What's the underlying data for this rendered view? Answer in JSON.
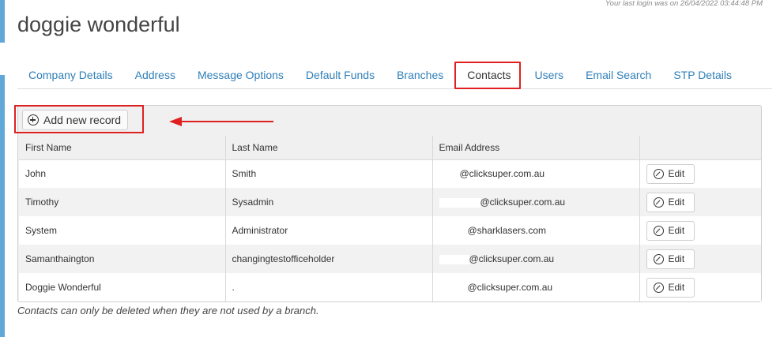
{
  "header": {
    "last_login": "Your last login was on 26/04/2022 03:44:48 PM",
    "page_title": "doggie wonderful"
  },
  "tabs": [
    {
      "label": "Company Details",
      "active": false
    },
    {
      "label": "Address",
      "active": false
    },
    {
      "label": "Message Options",
      "active": false
    },
    {
      "label": "Default Funds",
      "active": false
    },
    {
      "label": "Branches",
      "active": false
    },
    {
      "label": "Contacts",
      "active": true
    },
    {
      "label": "Users",
      "active": false
    },
    {
      "label": "Email Search",
      "active": false
    },
    {
      "label": "STP Details",
      "active": false
    }
  ],
  "toolbar": {
    "add_label": "Add new record",
    "add_icon": "plus-circle-icon"
  },
  "table": {
    "columns": [
      "First Name",
      "Last Name",
      "Email Address",
      ""
    ],
    "edit_label": "Edit",
    "edit_icon": "compass-edit-icon",
    "rows": [
      {
        "first": "John",
        "last": "Smith",
        "email": "@clicksuper.com.au"
      },
      {
        "first": "Timothy",
        "last": "Sysadmin",
        "email": "@clicksuper.com.au"
      },
      {
        "first": "System",
        "last": "Administrator",
        "email": "@sharklasers.com"
      },
      {
        "first": "Samanthaington",
        "last": "changingtestofficeholder",
        "email": "@clicksuper.com.au"
      },
      {
        "first": "Doggie Wonderful",
        "last": ".",
        "email": "@clicksuper.com.au"
      }
    ]
  },
  "footnote": "Contacts can only be deleted when they are not used by a branch.",
  "colors": {
    "accent_blue": "#2f7fb7",
    "highlight_red": "#e02020",
    "sidebar_blue": "#5fa8d8"
  }
}
